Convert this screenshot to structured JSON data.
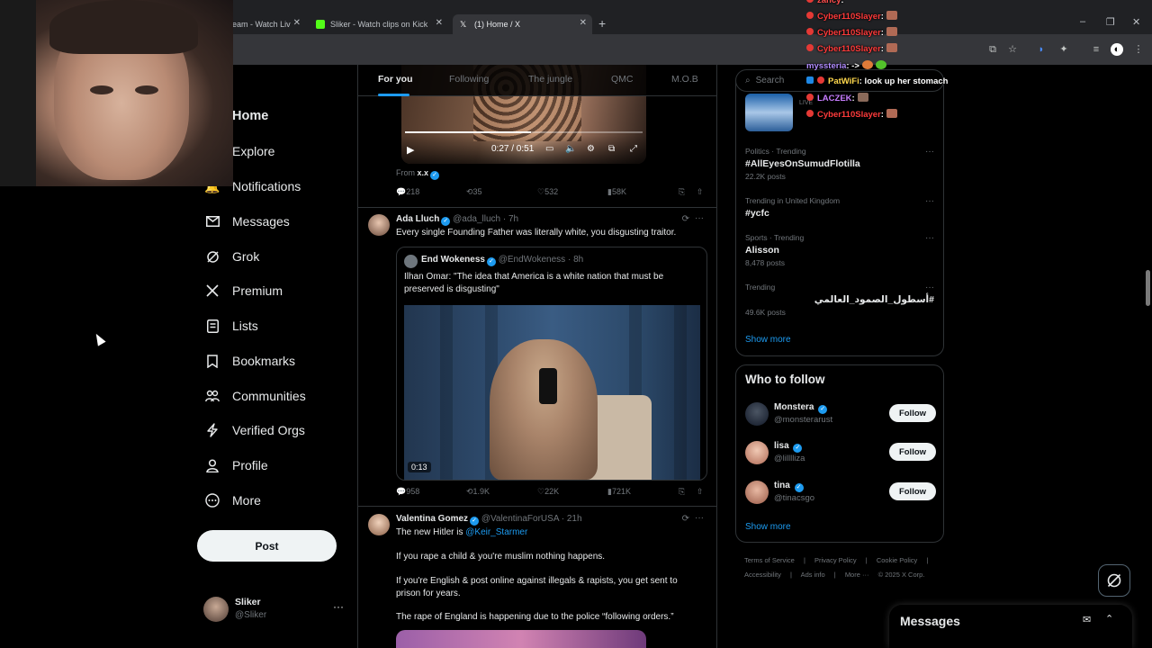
{
  "browser": {
    "tabs": [
      {
        "label": "eam - Watch Liv"
      },
      {
        "label": "Sliker - Watch clips on Kick"
      },
      {
        "label": "(1) Home / X"
      }
    ],
    "new_tab": "+",
    "window_controls": [
      "–",
      "❐",
      "✕"
    ]
  },
  "nav": {
    "items": [
      {
        "label": "Home",
        "icon": "home-icon"
      },
      {
        "label": "Explore",
        "icon": "search-icon"
      },
      {
        "label": "Notifications",
        "icon": "bell-icon"
      },
      {
        "label": "Messages",
        "icon": "envelope-icon"
      },
      {
        "label": "Grok",
        "icon": "grok-icon"
      },
      {
        "label": "Premium",
        "icon": "x-logo-icon"
      },
      {
        "label": "Lists",
        "icon": "list-icon"
      },
      {
        "label": "Bookmarks",
        "icon": "bookmark-icon"
      },
      {
        "label": "Communities",
        "icon": "people-icon"
      },
      {
        "label": "Verified Orgs",
        "icon": "lightning-icon"
      },
      {
        "label": "Profile",
        "icon": "person-icon"
      },
      {
        "label": "More",
        "icon": "more-circle-icon"
      }
    ],
    "post_label": "Post",
    "account": {
      "name": "Sliker",
      "handle": "@Sliker",
      "more": "···"
    }
  },
  "feed": {
    "tabs": [
      "For you",
      "Following",
      "The jungle",
      "QMC",
      "M.O.B"
    ],
    "video1": {
      "time": "0:27 / 0:51",
      "from_label": "From",
      "from_name": "x.x",
      "progress": 0.53
    },
    "tweet1_stats": {
      "replies": "218",
      "reposts": "35",
      "likes": "532",
      "views": "58K"
    },
    "tweet2": {
      "name": "Ada Lluch",
      "handle": "@ada_lluch",
      "time": "· 7h",
      "text": "Every single Founding Father was literally white, you disgusting traitor.",
      "quote": {
        "name": "End Wokeness",
        "handle": "@EndWokeness",
        "time": "· 8h",
        "text": "Ilhan Omar: \"The idea that America is a white nation that must be preserved is disgusting\"",
        "duration": "0:13"
      },
      "stats": {
        "replies": "958",
        "reposts": "1.9K",
        "likes": "22K",
        "views": "721K"
      }
    },
    "tweet3": {
      "name": "Valentina Gomez",
      "handle": "@ValentinaForUSA",
      "time": "· 21h",
      "line1_prefix": "The new Hitler is",
      "line1_mention": "@Keir_Starmer",
      "line2": "If you rape a child & you're muslim nothing happens.",
      "line3": "If you're English & post online against illegals & rapists, you get sent to prison for years.",
      "line4": "The rape of England is happening due to the police “following orders.”"
    }
  },
  "right": {
    "search_placeholder": "Search",
    "live_label": "LIVE",
    "trends": [
      {
        "category": "Politics · Trending",
        "name": "#AllEyesOnSumudFlotilla",
        "count": "22.2K posts"
      },
      {
        "category": "Trending in United Kingdom",
        "name": "#ycfc",
        "count": ""
      },
      {
        "category": "Sports · Trending",
        "name": "Alisson",
        "count": "8,478 posts"
      },
      {
        "category": "Trending",
        "name": "#أسطول_الصمود_العالمي",
        "count": "49.6K posts"
      }
    ],
    "show_more": "Show more",
    "who_to_follow": {
      "title": "Who to follow",
      "users": [
        {
          "name": "Monstera",
          "handle": "@monsterarust",
          "button": "Follow"
        },
        {
          "name": "lisa",
          "handle": "@lilllliza",
          "button": "Follow"
        },
        {
          "name": "tina",
          "handle": "@tinacsgo",
          "button": "Follow"
        }
      ],
      "show_more": "Show more"
    },
    "footer": {
      "row1": [
        "Terms of Service",
        "|",
        "Privacy Policy",
        "|",
        "Cookie Policy",
        "|"
      ],
      "row2": [
        "Accessibility",
        "|",
        "Ads info",
        "|",
        "More ···",
        "© 2025 X Corp."
      ]
    },
    "messages_drawer": "Messages"
  },
  "chat": [
    {
      "user": "zancy",
      "text": ":",
      "color": "#ff4d4d"
    },
    {
      "user": "Cyber110Slayer",
      "text": ":",
      "color": "#ff3b3b"
    },
    {
      "user": "Cyber110Slayer",
      "text": ":",
      "color": "#ff3b3b"
    },
    {
      "user": "Cyber110Slayer",
      "text": ":",
      "color": "#ff3b3b"
    },
    {
      "user": "myssteria",
      "text": ": ->",
      "color": "#b28dff"
    },
    {
      "user": "PatWiFi",
      "text": ": look up her stomach",
      "color": "#ffd84d"
    },
    {
      "user": "LACZEK",
      "text": ":",
      "color": "#c77dff"
    },
    {
      "user": "Cyber110Slayer",
      "text": ":",
      "color": "#ff3b3b"
    }
  ],
  "colors": {
    "accent": "#1d9bf0",
    "background": "#000000",
    "border": "#2f3336",
    "muted": "#71767b"
  }
}
